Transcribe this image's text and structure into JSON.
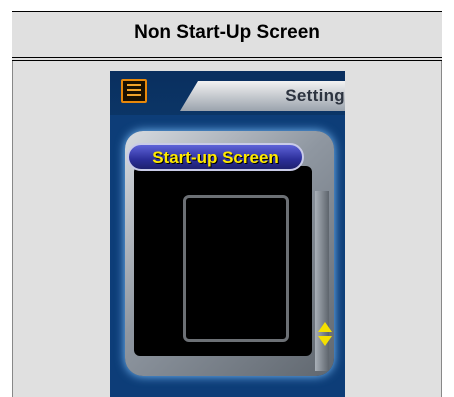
{
  "header": {
    "title": "Non Start-Up Screen"
  },
  "device": {
    "tab_label": "Setting",
    "menu_item_label": "Start-up Screen",
    "icons": {
      "menu": "menu-list-icon",
      "scroll": "up-down-arrows-icon"
    },
    "colors": {
      "screen_bg": "#0d3d78",
      "label_yellow": "#ffea00",
      "pill_blue": "#2c2f9a",
      "menu_orange": "#e8880a"
    }
  }
}
